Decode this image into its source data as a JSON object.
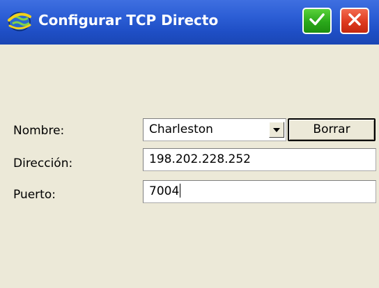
{
  "window": {
    "title": "Configurar TCP Directo",
    "ok_icon": "checkmark-icon",
    "close_icon": "close-x-icon",
    "app_icon": "globe-satellite-icon"
  },
  "form": {
    "nombre_label": "Nombre:",
    "nombre_value": "Charleston",
    "borrar_label": "Borrar",
    "direccion_label": "Dirección:",
    "direccion_value": "198.202.228.252",
    "puerto_label": "Puerto:",
    "puerto_value": "7004"
  },
  "colors": {
    "titlebar": "#2d5fd6",
    "background": "#ece9d8",
    "ok_button": "#2aa81a",
    "close_button": "#de3a1f"
  }
}
